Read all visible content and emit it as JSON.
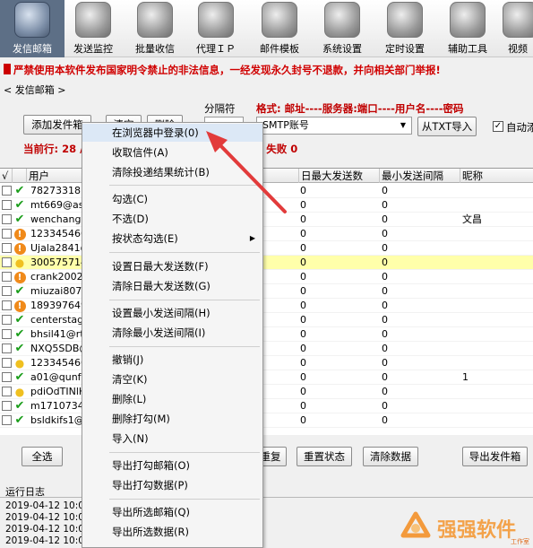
{
  "toolbar": {
    "items": [
      {
        "label": "发信邮箱",
        "icon": "mail-at-icon"
      },
      {
        "label": "发送监控",
        "icon": "play-monitor-icon"
      },
      {
        "label": "批量收信",
        "icon": "inbox-icon"
      },
      {
        "label": "代理ＩＰ",
        "icon": "proxy-icon"
      },
      {
        "label": "邮件模板",
        "icon": "template-icon"
      },
      {
        "label": "系统设置",
        "icon": "gear-icon"
      },
      {
        "label": "定时设置",
        "icon": "clock-icon"
      },
      {
        "label": "辅助工具",
        "icon": "tools-icon"
      },
      {
        "label": "视频",
        "icon": "video-icon"
      }
    ]
  },
  "warning": "严禁使用本软件发布国家明令禁止的非法信息，一经发现永久封号不退款，并向相关部门举报!",
  "breadcrumb": "< 发信邮箱 >",
  "controls": {
    "add_button": "添加发件箱",
    "btn2": "清空",
    "btn3": "删除",
    "sep_label": "分隔符",
    "format_label": "格式: 邮址----服务器:端口----用户名----密码",
    "combo_value": "SMTP账号",
    "import_button": "从TXT导入",
    "auto_label": "自动添",
    "current_row": "当前行: 28 /",
    "fail_text": "/ 失败 0"
  },
  "grid": {
    "headers": {
      "check": "√",
      "user": "用户",
      "daily_max": "日最大发送数",
      "min_interval": "最小发送间隔",
      "nickname": "昵称"
    },
    "rows": [
      {
        "status": "ok",
        "user": "78273318",
        "c1": "0",
        "c2": "0",
        "c3": ""
      },
      {
        "status": "ok",
        "user": "mt669@aso",
        "c1": "0",
        "c2": "0",
        "c3": ""
      },
      {
        "status": "ok",
        "user": "wenchang@",
        "c1": "0",
        "c2": "0",
        "c3": "文昌"
      },
      {
        "status": "warn",
        "user": "123345466",
        "c1": "0",
        "c2": "0",
        "c3": ""
      },
      {
        "status": "warn",
        "user": "Ujala2841@",
        "c1": "0",
        "c2": "0",
        "c3": ""
      },
      {
        "status": "bulb",
        "user": "300575714",
        "c1": "0",
        "c2": "0",
        "c3": "",
        "selected": true
      },
      {
        "status": "warn",
        "user": "crank2002@",
        "c1": "0",
        "c2": "0",
        "c3": ""
      },
      {
        "status": "ok",
        "user": "miuzai8075",
        "c1": "0",
        "c2": "0",
        "c3": ""
      },
      {
        "status": "warn",
        "user": "189397649",
        "c1": "0",
        "c2": "0",
        "c3": ""
      },
      {
        "status": "ok",
        "user": "centerstage",
        "c1": "0",
        "c2": "0",
        "c3": ""
      },
      {
        "status": "ok",
        "user": "bhsil41@rtr",
        "c1": "0",
        "c2": "0",
        "c3": ""
      },
      {
        "status": "ok",
        "user": "NXQ5SDB@",
        "c1": "0",
        "c2": "0",
        "c3": ""
      },
      {
        "status": "bulb",
        "user": "123345466",
        "c1": "0",
        "c2": "0",
        "c3": ""
      },
      {
        "status": "ok",
        "user": "a01@qunfa",
        "c1": "0",
        "c2": "0",
        "c3": "1"
      },
      {
        "status": "bulb",
        "user": "pdiOdTINlH",
        "c1": "0",
        "c2": "0",
        "c3": ""
      },
      {
        "status": "ok",
        "user": "m1710734",
        "c1": "0",
        "c2": "0",
        "c3": ""
      },
      {
        "status": "ok",
        "user": "bsldkifs1@",
        "c1": "0",
        "c2": "0",
        "c3": ""
      }
    ]
  },
  "bottom_buttons": {
    "select_all": "全选",
    "repeat": "重复",
    "reset_status": "重置状态",
    "clear_data": "清除数据",
    "export": "导出发件箱"
  },
  "log": {
    "title": "运行日志",
    "lines": [
      "2019-04-12 10:01",
      "2019-04-12 10:01",
      "2019-04-12 10:01",
      "2019-04-12 10:01"
    ]
  },
  "context_menu": {
    "items": [
      "在浏览器中登录(0)",
      "收取信件(A)",
      "清除投递结果统计(B)",
      "勾选(C)",
      "不选(D)",
      "按状态勾选(E)",
      "设置日最大发送数(F)",
      "清除日最大发送数(G)",
      "设置最小发送间隔(H)",
      "清除最小发送间隔(I)",
      "撤销(J)",
      "清空(K)",
      "删除(L)",
      "删除打勾(M)",
      "导入(N)",
      "导出打勾邮箱(O)",
      "导出打勾数据(P)",
      "导出所选邮箱(Q)",
      "导出所选数据(R)"
    ]
  },
  "watermark": {
    "text": "强强软件",
    "sub": "工作室"
  },
  "colors": {
    "accent": "#d00000",
    "annotation_arrow": "#e23b3b",
    "active_tab": "#5d6f86",
    "selected_row": "#ffffaa"
  }
}
